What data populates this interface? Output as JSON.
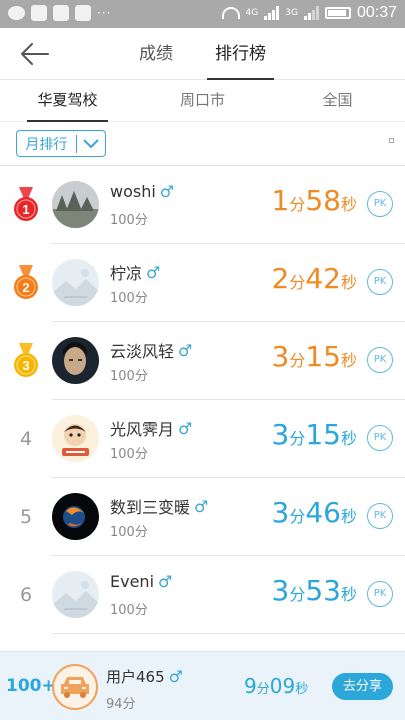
{
  "status_bar": {
    "network_1": "4G",
    "network_2": "3G",
    "time": "00:37"
  },
  "header": {
    "tabs": [
      {
        "label": "成绩",
        "active": false
      },
      {
        "label": "排行榜",
        "active": true
      }
    ]
  },
  "subtabs": [
    {
      "label": "华夏驾校",
      "active": true
    },
    {
      "label": "周口市",
      "active": false
    },
    {
      "label": "全国",
      "active": false
    }
  ],
  "filter": {
    "selected": "月排行"
  },
  "colors": {
    "accent_blue": "#2ba7da",
    "accent_orange": "#f08a24",
    "medal_gold": "#f7b500",
    "medal_silver_orange": "#f57c16",
    "medal_red": "#e8262a"
  },
  "ranking": [
    {
      "rank": "1",
      "medal": "red-medal-icon",
      "name": "woshi",
      "gender_icon": "male-icon",
      "score": "100分",
      "min": "1",
      "min_unit": "分",
      "sec": "58",
      "sec_unit": "秒",
      "time_color": "orange",
      "pk": "PK",
      "avatar": "foggy-trees-avatar"
    },
    {
      "rank": "2",
      "medal": "orange-medal-icon",
      "name": "柠凉",
      "gender_icon": "male-icon",
      "score": "100分",
      "min": "2",
      "min_unit": "分",
      "sec": "42",
      "sec_unit": "秒",
      "time_color": "orange",
      "pk": "PK",
      "avatar": "default-avatar"
    },
    {
      "rank": "3",
      "medal": "gold-medal-icon",
      "name": "云淡风轻",
      "gender_icon": "male-icon",
      "score": "100分",
      "min": "3",
      "min_unit": "分",
      "sec": "15",
      "sec_unit": "秒",
      "time_color": "orange",
      "pk": "PK",
      "avatar": "portrait-avatar"
    },
    {
      "rank": "4",
      "medal": "",
      "name": "光风霁月",
      "gender_icon": "male-icon",
      "score": "100分",
      "min": "3",
      "min_unit": "分",
      "sec": "15",
      "sec_unit": "秒",
      "time_color": "blue",
      "pk": "PK",
      "avatar": "cartoon-avatar"
    },
    {
      "rank": "5",
      "medal": "",
      "name": "数到三变暖",
      "gender_icon": "male-icon",
      "score": "100分",
      "min": "3",
      "min_unit": "分",
      "sec": "46",
      "sec_unit": "秒",
      "time_color": "blue",
      "pk": "PK",
      "avatar": "dark-orb-avatar"
    },
    {
      "rank": "6",
      "medal": "",
      "name": "Eveni",
      "gender_icon": "male-icon",
      "score": "100分",
      "min": "3",
      "min_unit": "分",
      "sec": "53",
      "sec_unit": "秒",
      "time_color": "blue",
      "pk": "PK",
      "avatar": "default-avatar"
    }
  ],
  "me": {
    "rank": "100+",
    "name": "用户465",
    "gender_icon": "male-icon",
    "score": "94分",
    "min": "9",
    "min_unit": "分",
    "sec": "09",
    "sec_unit": "秒",
    "share_label": "去分享",
    "avatar": "car-avatar"
  }
}
